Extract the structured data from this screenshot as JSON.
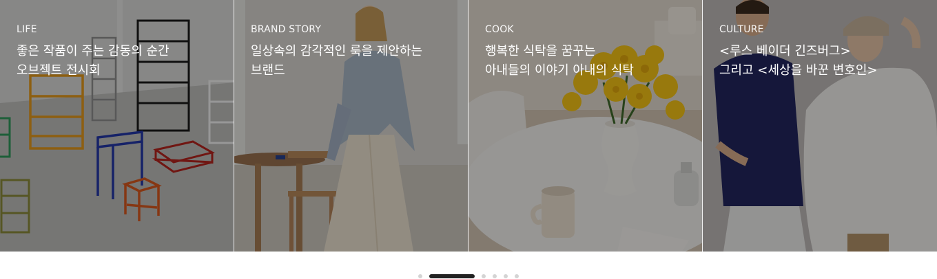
{
  "cards": [
    {
      "category": "LIFE",
      "title_line1": "좋은 작품이 주는 감동의 순간",
      "title_line2": "오브젝트 전시회"
    },
    {
      "category": "BRAND STORY",
      "title_line1": "일상속의 감각적인 룩을 제안하는",
      "title_line2": "브랜드"
    },
    {
      "category": "COOK",
      "title_line1": "행복한 식탁을 꿈꾸는",
      "title_line2": "아내들의 이야기 아내의 식탁"
    },
    {
      "category": "CULTURE",
      "title_line1": "<루스 베이더 긴즈버그>",
      "title_line2": "그리고 <세상을 바꾼 변호인>"
    }
  ],
  "pagination": {
    "active_index": 1,
    "count": 6
  },
  "colors": {
    "dot_active": "#222222",
    "dot_inactive": "#d4d4d4"
  }
}
